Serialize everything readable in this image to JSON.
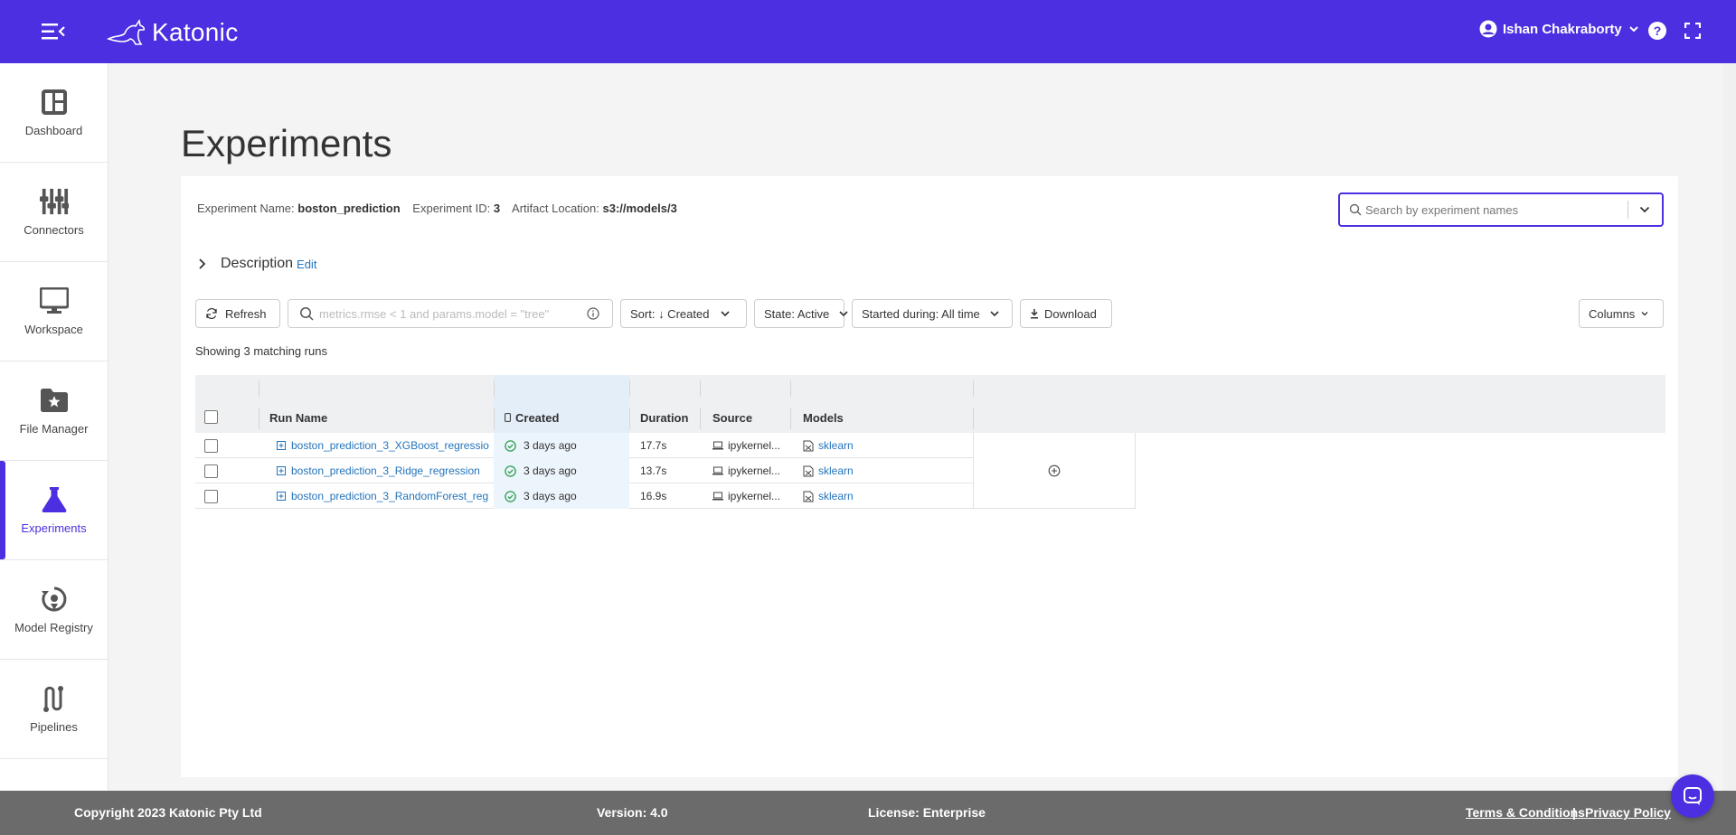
{
  "app": {
    "brand": "Katonic",
    "user_name": "Ishan Chakraborty"
  },
  "sidebar": {
    "items": [
      {
        "label": "Dashboard",
        "icon": "dashboard-icon",
        "active": false
      },
      {
        "label": "Connectors",
        "icon": "connectors-icon",
        "active": false
      },
      {
        "label": "Workspace",
        "icon": "monitor-icon",
        "active": false
      },
      {
        "label": "File Manager",
        "icon": "folder-star-icon",
        "active": false
      },
      {
        "label": "Experiments",
        "icon": "flask-icon",
        "active": true
      },
      {
        "label": "Model Registry",
        "icon": "model-registry-icon",
        "active": false
      },
      {
        "label": "Pipelines",
        "icon": "pipelines-icon",
        "active": false
      }
    ]
  },
  "page": {
    "title": "Experiments",
    "experiment_name_label": "Experiment Name:",
    "experiment_name": "boston_prediction",
    "experiment_id_label": "Experiment ID:",
    "experiment_id": "3",
    "artifact_label": "Artifact Location:",
    "artifact_location": "s3://models/3",
    "search_placeholder": "Search by experiment names",
    "description_label": "Description",
    "edit_label": "Edit"
  },
  "toolbar": {
    "refresh": "Refresh",
    "filter_placeholder": "metrics.rmse < 1 and params.model = \"tree\"",
    "sort": "Sort: ↓ Created",
    "state": "State: Active",
    "started": "Started during: All time",
    "download": "Download",
    "columns": "Columns"
  },
  "runs_count": "Showing 3 matching runs",
  "table": {
    "headers": {
      "run_name": "Run Name",
      "created": "Created",
      "duration": "Duration",
      "source": "Source",
      "models": "Models"
    },
    "rows": [
      {
        "run_name": "boston_prediction_3_XGBoost_regressio",
        "created": "3 days ago",
        "duration": "17.7s",
        "source": "ipykernel...",
        "model": "sklearn"
      },
      {
        "run_name": "boston_prediction_3_Ridge_regression",
        "created": "3 days ago",
        "duration": "13.7s",
        "source": "ipykernel...",
        "model": "sklearn"
      },
      {
        "run_name": "boston_prediction_3_RandomForest_reg",
        "created": "3 days ago",
        "duration": "16.9s",
        "source": "ipykernel...",
        "model": "sklearn"
      }
    ]
  },
  "footer": {
    "copyright": "Copyright 2023 Katonic Pty Ltd",
    "version": "Version: 4.0",
    "license": "License: Enterprise",
    "terms": "Terms & Conditions",
    "separator": "|",
    "privacy": "Privacy Policy"
  },
  "colors": {
    "brand": "#4b2fe0",
    "link": "#2374bb",
    "success": "#2e9e4f",
    "footer": "#6b6b6b"
  }
}
